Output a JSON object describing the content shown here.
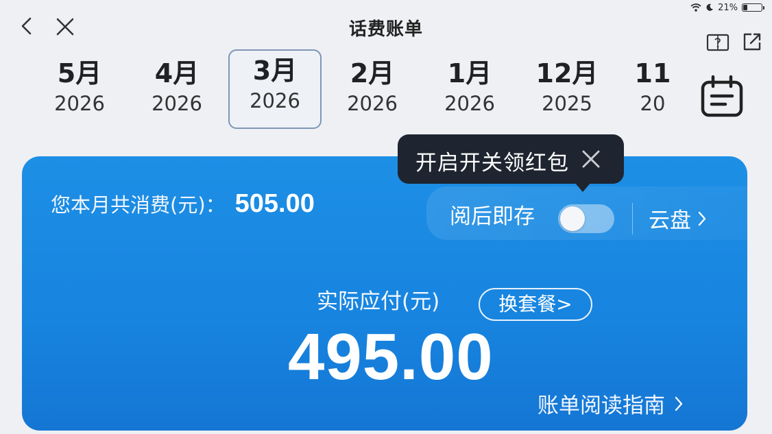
{
  "status_bar": {
    "battery": "21%",
    "battery_level": 0.21
  },
  "nav": {
    "title": "话费账单"
  },
  "months": [
    {
      "month": "5月",
      "year": "2026",
      "active": false
    },
    {
      "month": "4月",
      "year": "2026",
      "active": false
    },
    {
      "month": "3月",
      "year": "2026",
      "active": true
    },
    {
      "month": "2月",
      "year": "2026",
      "active": false
    },
    {
      "month": "1月",
      "year": "2026",
      "active": false
    },
    {
      "month": "12月",
      "year": "2025",
      "active": false
    },
    {
      "month": "11",
      "year": "20",
      "active": false
    }
  ],
  "bill": {
    "spend_label": "您本月共消费(元)：",
    "spend_value": "505.00",
    "save_label": "阅后即存",
    "save_toggle_on": false,
    "cloud_label": "云盘",
    "tooltip": "开启开关领红包",
    "pay_label": "实际应付(元)",
    "plan_button": "换套餐>",
    "amount": "495.00",
    "guide_label": "账单阅读指南"
  },
  "colors": {
    "card_blue": "#1784df",
    "tooltip_bg": "#1e2530",
    "active_border": "#7f95b6"
  }
}
